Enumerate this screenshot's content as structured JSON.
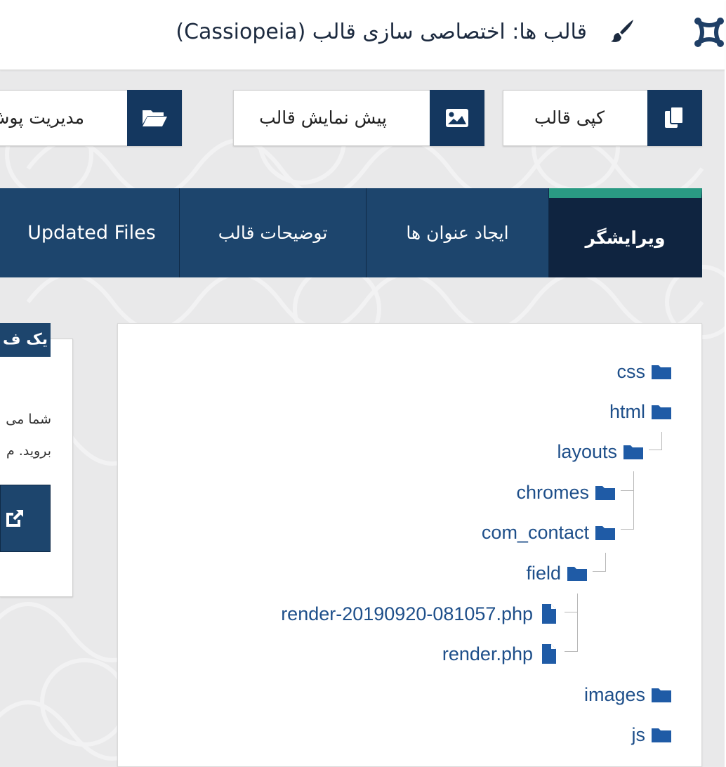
{
  "header": {
    "title": "قالب ها: اختصاصی سازی قالب (Cassiopeia)",
    "logo_icon": "joomla-logo-icon",
    "title_icon": "paint-brush-icon"
  },
  "toolbar": {
    "copy_label": "کپی قالب",
    "preview_label": "پیش نمایش قالب",
    "manage_label": "مدیریت پوش",
    "copy_icon": "copy-icon",
    "preview_icon": "image-icon",
    "manage_icon": "folder-open-icon"
  },
  "tabs": [
    {
      "label": "ویرایشگر",
      "active": true
    },
    {
      "label": "ایجاد عنوان ها",
      "active": false
    },
    {
      "label": "توضیحات قالب",
      "active": false
    },
    {
      "label": "Updated Files",
      "active": false
    }
  ],
  "info": {
    "title": "یک ف",
    "line1": "شما می",
    "line2": "بروید. م",
    "button_icon": "external-link-icon"
  },
  "tree": [
    {
      "label": "css",
      "type": "folder"
    },
    {
      "label": "html",
      "type": "folder"
    },
    {
      "label": "layouts",
      "type": "folder"
    },
    {
      "label": "chromes",
      "type": "folder"
    },
    {
      "label": "com_contact",
      "type": "folder"
    },
    {
      "label": "field",
      "type": "folder"
    },
    {
      "label": "render-20190920-081057.php",
      "type": "file"
    },
    {
      "label": "render.php",
      "type": "file"
    },
    {
      "label": "images",
      "type": "folder"
    },
    {
      "label": "js",
      "type": "folder"
    }
  ],
  "colors": {
    "brand_dark": "#14375f",
    "tab_bg": "#1d456d",
    "tab_active": "#0f2440",
    "tab_active_accent": "#2a9a83",
    "link": "#1e4f8a",
    "folder": "#1f5ba6"
  }
}
